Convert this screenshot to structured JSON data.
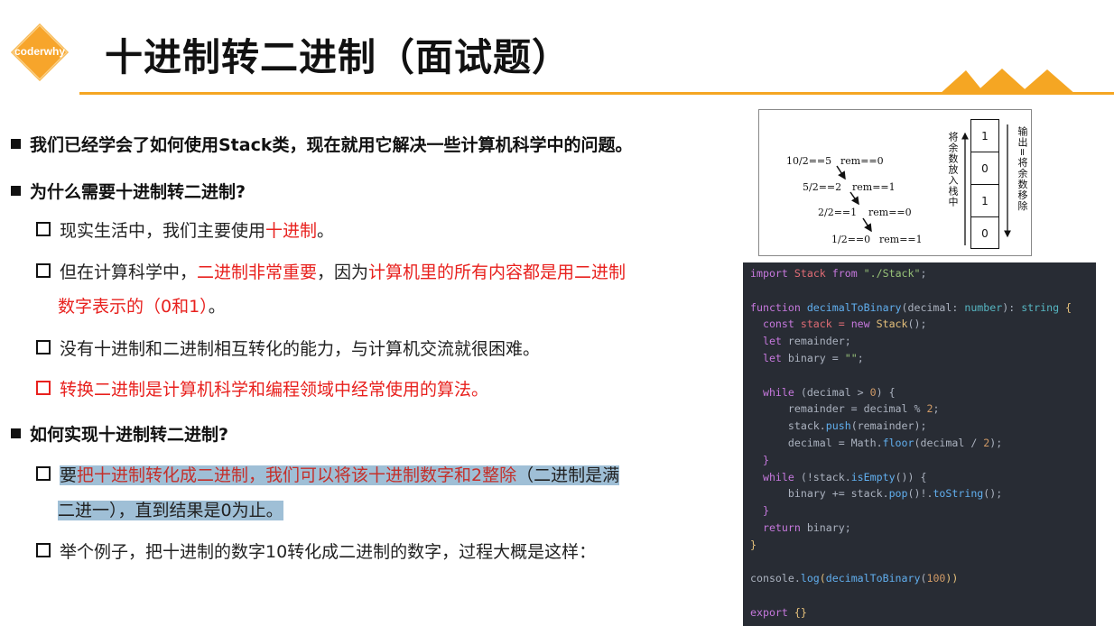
{
  "header": {
    "logo_text": "coderwhy",
    "title": "十进制转二进制（面试题）"
  },
  "bullets": {
    "b1": "我们已经学会了如何使用Stack类，现在就用它解决一些计算机科学中的问题。",
    "b2": "为什么需要十进制转二进制?",
    "b2_1_pre": "现实生活中，我们主要使用",
    "b2_1_red": "十进制",
    "b2_1_post": "。",
    "b2_2_pre": "但在计算科学中，",
    "b2_2_red1": "二进制非常重要",
    "b2_2_mid": "，因为",
    "b2_2_red2": "计算机里的所有内容都是用二进制",
    "b2_2_cont_red": "数字表示的（0和1）",
    "b2_2_cont_post": "。",
    "b2_3": "没有十进制和二进制相互转化的能力，与计算机交流就很困难。",
    "b2_4": "转换二进制是计算机科学和编程领域中经常使用的算法。",
    "b3": "如何实现十进制转二进制?",
    "b3_1_pre": "要",
    "b3_1_red": "把十进制转化成二进制，我们可以将该十进制数字和2整除",
    "b3_1_post": "（二进制是满",
    "b3_1_cont": "二进一），直到结果是0为止。",
    "b3_2": "举个例子，把十进制的数字10转化成二进制的数字，过程大概是这样："
  },
  "figure": {
    "steps": [
      {
        "div": "10/2==5",
        "rem": "rem==0"
      },
      {
        "div": "5/2==2",
        "rem": "rem==1"
      },
      {
        "div": "2/2==1",
        "rem": "rem==0"
      },
      {
        "div": "1/2==0",
        "rem": "rem==1"
      }
    ],
    "push_label": "将余数放入栈中",
    "pop_label": "输出=将余数移除",
    "stack_cells": [
      "1",
      "0",
      "1",
      "0"
    ]
  },
  "code": {
    "lines": [
      [
        {
          "t": "import ",
          "c": "#c678dd"
        },
        {
          "t": "Stack ",
          "c": "#e06c75"
        },
        {
          "t": "from ",
          "c": "#c678dd"
        },
        {
          "t": "\"./Stack\"",
          "c": "#98c379"
        },
        {
          "t": ";",
          "c": "#abb2bf"
        }
      ],
      [],
      [
        {
          "t": "function ",
          "c": "#c678dd"
        },
        {
          "t": "decimalToBinary",
          "c": "#61afef"
        },
        {
          "t": "(decimal: ",
          "c": "#abb2bf"
        },
        {
          "t": "number",
          "c": "#56b6c2"
        },
        {
          "t": "): ",
          "c": "#abb2bf"
        },
        {
          "t": "string",
          "c": "#56b6c2"
        },
        {
          "t": " {",
          "c": "#e5c07b"
        }
      ],
      [
        {
          "t": "  const ",
          "c": "#c678dd"
        },
        {
          "t": "stack = ",
          "c": "#e06c75"
        },
        {
          "t": "new ",
          "c": "#c678dd"
        },
        {
          "t": "Stack",
          "c": "#e5c07b"
        },
        {
          "t": "();",
          "c": "#abb2bf"
        }
      ],
      [
        {
          "t": "  let ",
          "c": "#c678dd"
        },
        {
          "t": "remainder;",
          "c": "#abb2bf"
        }
      ],
      [
        {
          "t": "  let ",
          "c": "#c678dd"
        },
        {
          "t": "binary = ",
          "c": "#abb2bf"
        },
        {
          "t": "\"\"",
          "c": "#98c379"
        },
        {
          "t": ";",
          "c": "#abb2bf"
        }
      ],
      [],
      [
        {
          "t": "  while ",
          "c": "#c678dd"
        },
        {
          "t": "(decimal > ",
          "c": "#abb2bf"
        },
        {
          "t": "0",
          "c": "#d19a66"
        },
        {
          "t": ") {",
          "c": "#abb2bf"
        }
      ],
      [
        {
          "t": "      remainder = decimal % ",
          "c": "#abb2bf"
        },
        {
          "t": "2",
          "c": "#d19a66"
        },
        {
          "t": ";",
          "c": "#abb2bf"
        }
      ],
      [
        {
          "t": "      stack.",
          "c": "#abb2bf"
        },
        {
          "t": "push",
          "c": "#61afef"
        },
        {
          "t": "(remainder);",
          "c": "#abb2bf"
        }
      ],
      [
        {
          "t": "      decimal = Math.",
          "c": "#abb2bf"
        },
        {
          "t": "floor",
          "c": "#61afef"
        },
        {
          "t": "(decimal / ",
          "c": "#abb2bf"
        },
        {
          "t": "2",
          "c": "#d19a66"
        },
        {
          "t": ");",
          "c": "#abb2bf"
        }
      ],
      [
        {
          "t": "  }",
          "c": "#c678dd"
        }
      ],
      [
        {
          "t": "  while ",
          "c": "#c678dd"
        },
        {
          "t": "(!stack.",
          "c": "#abb2bf"
        },
        {
          "t": "isEmpty",
          "c": "#61afef"
        },
        {
          "t": "()) {",
          "c": "#abb2bf"
        }
      ],
      [
        {
          "t": "      binary += stack.",
          "c": "#abb2bf"
        },
        {
          "t": "pop",
          "c": "#61afef"
        },
        {
          "t": "()!.",
          "c": "#abb2bf"
        },
        {
          "t": "toString",
          "c": "#61afef"
        },
        {
          "t": "();",
          "c": "#abb2bf"
        }
      ],
      [
        {
          "t": "  }",
          "c": "#c678dd"
        }
      ],
      [
        {
          "t": "  return ",
          "c": "#c678dd"
        },
        {
          "t": "binary;",
          "c": "#abb2bf"
        }
      ],
      [
        {
          "t": "}",
          "c": "#e5c07b"
        }
      ],
      [],
      [
        {
          "t": "console.",
          "c": "#abb2bf"
        },
        {
          "t": "log",
          "c": "#61afef"
        },
        {
          "t": "(",
          "c": "#e5c07b"
        },
        {
          "t": "decimalToBinary",
          "c": "#61afef"
        },
        {
          "t": "(",
          "c": "#abb2bf"
        },
        {
          "t": "100",
          "c": "#d19a66"
        },
        {
          "t": "))",
          "c": "#e5c07b"
        }
      ],
      [],
      [
        {
          "t": "export ",
          "c": "#c678dd"
        },
        {
          "t": "{}",
          "c": "#e5c07b"
        }
      ]
    ]
  },
  "colors": {
    "accent": "#f5a623",
    "highlight_red": "#e8211e",
    "selection": "#9fbfd6",
    "code_bg": "#282c34"
  }
}
